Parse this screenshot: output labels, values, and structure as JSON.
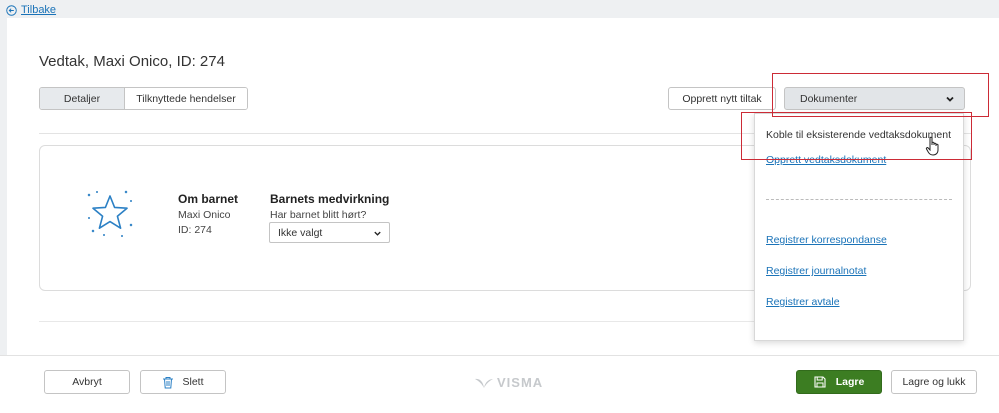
{
  "back": {
    "label": "Tilbake"
  },
  "page": {
    "title": "Vedtak, Maxi Onico, ID: 274"
  },
  "tabs": [
    {
      "label": "Detaljer",
      "active": true
    },
    {
      "label": "Tilknyttede hendelser",
      "active": false
    }
  ],
  "toolbar": {
    "new_action_label": "Opprett nytt tiltak",
    "documents_label": "Dokumenter"
  },
  "documents_menu": {
    "items": [
      "Koble til eksisterende vedtaksdokument",
      "Opprett vedtaksdokument",
      "Registrer korrespondanse",
      "Registrer journalnotat",
      "Registrer avtale"
    ]
  },
  "child": {
    "title": "Om barnet",
    "name": "Maxi Onico",
    "id_text": "ID: 274"
  },
  "participation": {
    "title": "Barnets medvirkning",
    "question": "Har barnet blitt hørt?",
    "selected": "Ikke valgt"
  },
  "footer": {
    "cancel_label": "Avbryt",
    "delete_label": "Slett",
    "logo_text": "VISMA",
    "save_label": "Lagre",
    "save_close_label": "Lagre og lukk"
  },
  "colors": {
    "accent": "#1a73b8",
    "primary_button": "#3c7d22",
    "highlight": "#cc2b36"
  }
}
